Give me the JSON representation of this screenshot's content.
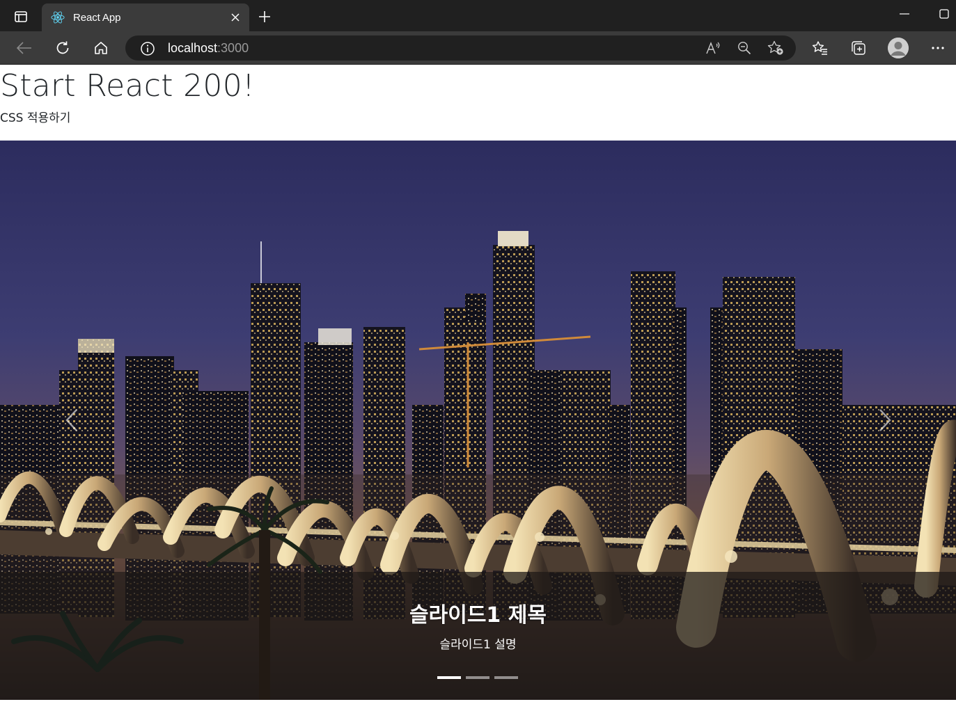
{
  "browser": {
    "tab_title": "React App",
    "url_host": "localhost",
    "url_port": ":3000",
    "icons": {
      "tab_actions": "tab-actions-icon",
      "favicon": "react-logo-icon",
      "tab_close": "close-icon",
      "new_tab": "plus-icon",
      "back": "arrow-left-icon",
      "refresh": "refresh-icon",
      "home": "home-icon",
      "site_info": "info-icon",
      "read_aloud": "read-aloud-icon",
      "zoom": "zoom-out-icon",
      "add_favorite": "star-add-icon",
      "favorites": "favorites-icon",
      "collections": "collections-icon",
      "profile": "profile-avatar-icon",
      "more": "more-icon",
      "minimize": "minimize-icon",
      "maximize": "maximize-icon"
    }
  },
  "page": {
    "title": "Start React 200!",
    "subtitle": "CSS 적용하기"
  },
  "carousel": {
    "slides": [
      {
        "image": "night-city-skyline-with-arched-bridge",
        "caption_title": "슬라이드1 제목",
        "caption_description": "슬라이드1 설명",
        "active": true
      },
      {
        "active": false
      },
      {
        "active": false
      }
    ],
    "prev_icon": "chevron-left-icon",
    "next_icon": "chevron-right-icon"
  },
  "colors": {
    "chrome_dark": "#202020",
    "chrome_mid": "#3b3b3b",
    "text_dark": "#212529",
    "sky_top": "#3b3d73",
    "sky_bottom": "#6b4a3a",
    "bridge_light": "#e9d7a8"
  }
}
